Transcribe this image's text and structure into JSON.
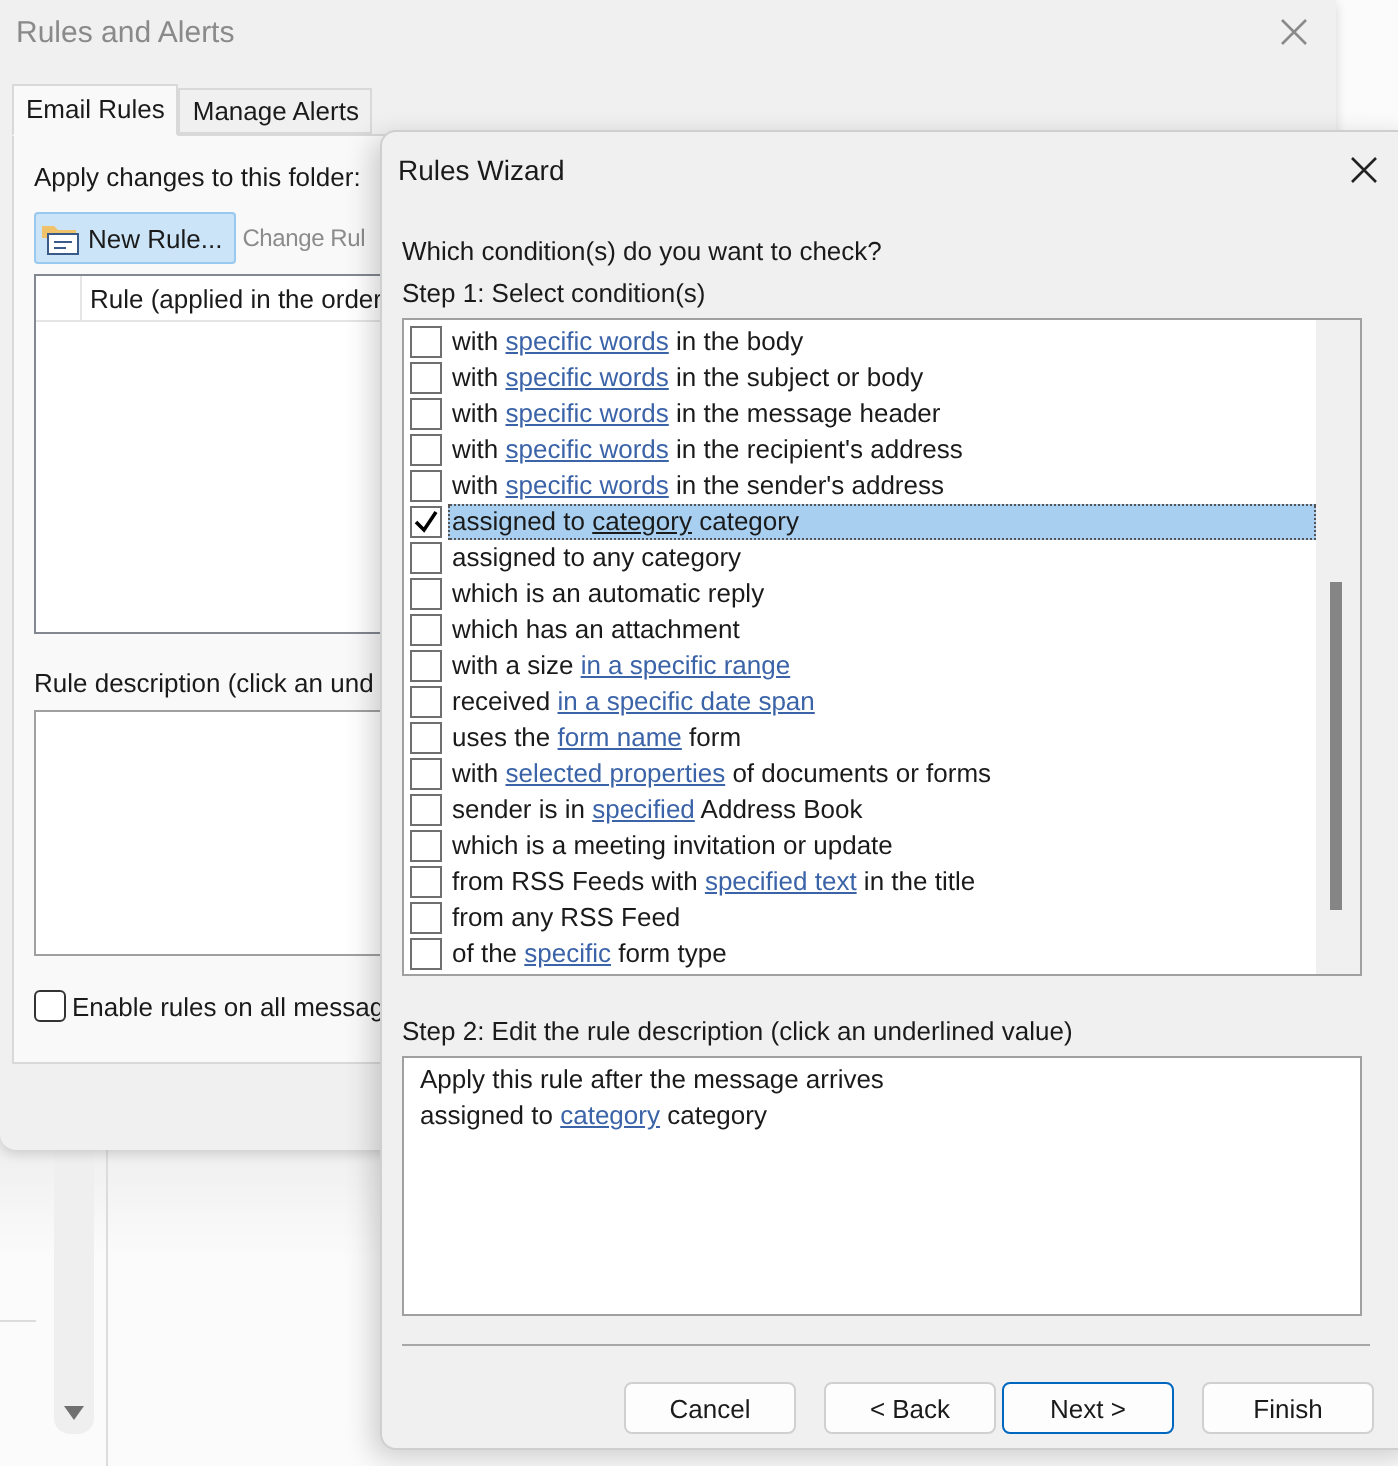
{
  "background_window": {
    "title": "Rules and Alerts",
    "tabs": [
      {
        "label": "Email Rules",
        "selected": true
      },
      {
        "label": "Manage Alerts",
        "selected": false
      }
    ],
    "folder_label": "Apply changes to this folder:",
    "toolbar": [
      {
        "label": "New Rule...",
        "disabled": false,
        "focused": true
      },
      {
        "label": "Change Rul",
        "disabled": true,
        "focused": false
      }
    ],
    "rules_table": {
      "columns": [
        "Rule (applied in the order"
      ]
    },
    "description_label": "Rule description (click an und",
    "enable_checkbox": {
      "label": "Enable rules on all messag",
      "checked": false
    }
  },
  "dialog": {
    "title": "Rules Wizard",
    "prompt": "Which condition(s) do you want to check?",
    "step1_label": "Step 1: Select condition(s)",
    "conditions": [
      {
        "segments": [
          {
            "kind": "text",
            "text": "with "
          },
          {
            "kind": "link",
            "text": "specific words"
          },
          {
            "kind": "text",
            "text": " in the body"
          }
        ],
        "checked": false,
        "selected": false
      },
      {
        "segments": [
          {
            "kind": "text",
            "text": "with "
          },
          {
            "kind": "link",
            "text": "specific words"
          },
          {
            "kind": "text",
            "text": " in the subject or body"
          }
        ],
        "checked": false,
        "selected": false
      },
      {
        "segments": [
          {
            "kind": "text",
            "text": "with "
          },
          {
            "kind": "link",
            "text": "specific words"
          },
          {
            "kind": "text",
            "text": " in the message header"
          }
        ],
        "checked": false,
        "selected": false
      },
      {
        "segments": [
          {
            "kind": "text",
            "text": "with "
          },
          {
            "kind": "link",
            "text": "specific words"
          },
          {
            "kind": "text",
            "text": " in the recipient's address"
          }
        ],
        "checked": false,
        "selected": false
      },
      {
        "segments": [
          {
            "kind": "text",
            "text": "with "
          },
          {
            "kind": "link",
            "text": "specific words"
          },
          {
            "kind": "text",
            "text": " in the sender's address"
          }
        ],
        "checked": false,
        "selected": false
      },
      {
        "segments": [
          {
            "kind": "text",
            "text": "assigned to "
          },
          {
            "kind": "link",
            "text": "category"
          },
          {
            "kind": "text",
            "text": " category"
          }
        ],
        "checked": true,
        "selected": true
      },
      {
        "segments": [
          {
            "kind": "text",
            "text": "assigned to any category"
          }
        ],
        "checked": false,
        "selected": false
      },
      {
        "segments": [
          {
            "kind": "text",
            "text": "which is an automatic reply"
          }
        ],
        "checked": false,
        "selected": false
      },
      {
        "segments": [
          {
            "kind": "text",
            "text": "which has an attachment"
          }
        ],
        "checked": false,
        "selected": false
      },
      {
        "segments": [
          {
            "kind": "text",
            "text": "with a size "
          },
          {
            "kind": "link",
            "text": "in a specific range"
          }
        ],
        "checked": false,
        "selected": false
      },
      {
        "segments": [
          {
            "kind": "text",
            "text": "received "
          },
          {
            "kind": "link",
            "text": "in a specific date span"
          }
        ],
        "checked": false,
        "selected": false
      },
      {
        "segments": [
          {
            "kind": "text",
            "text": "uses the "
          },
          {
            "kind": "link",
            "text": "form name"
          },
          {
            "kind": "text",
            "text": " form"
          }
        ],
        "checked": false,
        "selected": false
      },
      {
        "segments": [
          {
            "kind": "text",
            "text": "with "
          },
          {
            "kind": "link",
            "text": "selected properties"
          },
          {
            "kind": "text",
            "text": " of documents or forms"
          }
        ],
        "checked": false,
        "selected": false
      },
      {
        "segments": [
          {
            "kind": "text",
            "text": "sender is in "
          },
          {
            "kind": "link",
            "text": "specified"
          },
          {
            "kind": "text",
            "text": " Address Book"
          }
        ],
        "checked": false,
        "selected": false
      },
      {
        "segments": [
          {
            "kind": "text",
            "text": "which is a meeting invitation or update"
          }
        ],
        "checked": false,
        "selected": false
      },
      {
        "segments": [
          {
            "kind": "text",
            "text": "from RSS Feeds with "
          },
          {
            "kind": "link",
            "text": "specified text"
          },
          {
            "kind": "text",
            "text": " in the title"
          }
        ],
        "checked": false,
        "selected": false
      },
      {
        "segments": [
          {
            "kind": "text",
            "text": "from any RSS Feed"
          }
        ],
        "checked": false,
        "selected": false
      },
      {
        "segments": [
          {
            "kind": "text",
            "text": "of the "
          },
          {
            "kind": "link",
            "text": "specific"
          },
          {
            "kind": "text",
            "text": " form type"
          }
        ],
        "checked": false,
        "selected": false
      }
    ],
    "step2_label": "Step 2: Edit the rule description (click an underlined value)",
    "description_lines": [
      [
        {
          "kind": "text",
          "text": "Apply this rule after the message arrives"
        }
      ],
      [
        {
          "kind": "text",
          "text": "assigned to "
        },
        {
          "kind": "link",
          "text": "category"
        },
        {
          "kind": "text",
          "text": " category"
        }
      ]
    ],
    "buttons": [
      {
        "label": "Cancel",
        "default": false
      },
      {
        "label": "< Back",
        "default": false
      },
      {
        "label": "Next >",
        "default": true
      },
      {
        "label": "Finish",
        "default": false
      }
    ]
  }
}
